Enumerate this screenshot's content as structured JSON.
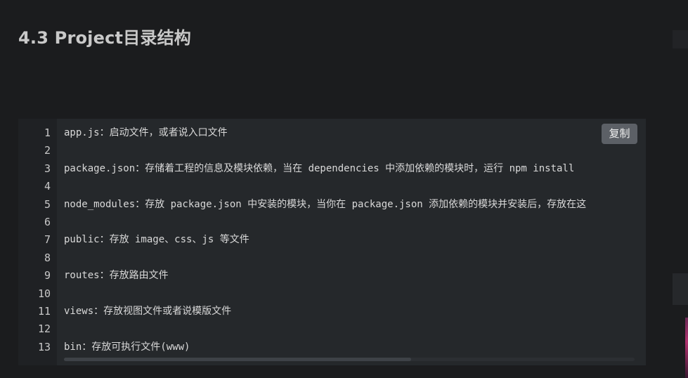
{
  "heading": "4.3 Project目录结构",
  "copy_button_label": "复制",
  "code_lines": [
    {
      "no": "1",
      "text": "app.js：启动文件，或者说入口文件"
    },
    {
      "no": "2",
      "text": ""
    },
    {
      "no": "3",
      "text": "package.json：存储着工程的信息及模块依赖，当在 dependencies 中添加依赖的模块时，运行 npm install"
    },
    {
      "no": "4",
      "text": ""
    },
    {
      "no": "5",
      "text": "node_modules：存放 package.json 中安装的模块，当你在 package.json 添加依赖的模块并安装后，存放在这"
    },
    {
      "no": "6",
      "text": ""
    },
    {
      "no": "7",
      "text": "public：存放 image、css、js 等文件"
    },
    {
      "no": "8",
      "text": ""
    },
    {
      "no": "9",
      "text": "routes：存放路由文件"
    },
    {
      "no": "10",
      "text": ""
    },
    {
      "no": "11",
      "text": "views：存放视图文件或者说模版文件"
    },
    {
      "no": "12",
      "text": ""
    },
    {
      "no": "13",
      "text": "bin：存放可执行文件(www)"
    }
  ],
  "colors": {
    "page_background": "#1b1c1e",
    "code_background": "#25282b",
    "gutter_background": "#1f2124",
    "copy_button_background": "#5c6066"
  }
}
